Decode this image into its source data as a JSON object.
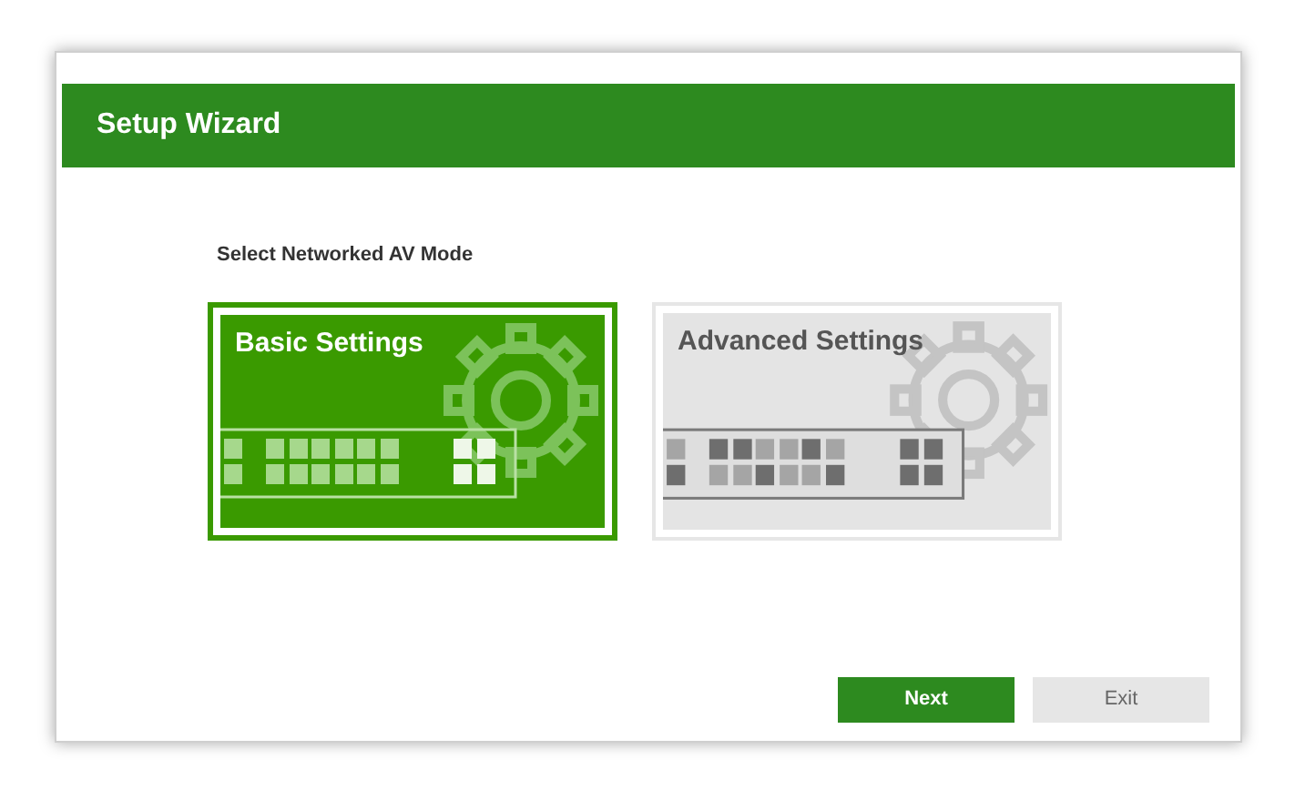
{
  "window": {
    "title": "Setup Wizard"
  },
  "prompt": "Select Networked AV Mode",
  "modes": [
    {
      "title": "Basic Settings",
      "selected": true
    },
    {
      "title": "Advanced Settings",
      "selected": false
    }
  ],
  "buttons": [
    {
      "label": "Next",
      "kind": "primary"
    },
    {
      "label": "Exit",
      "kind": "secondary"
    }
  ]
}
